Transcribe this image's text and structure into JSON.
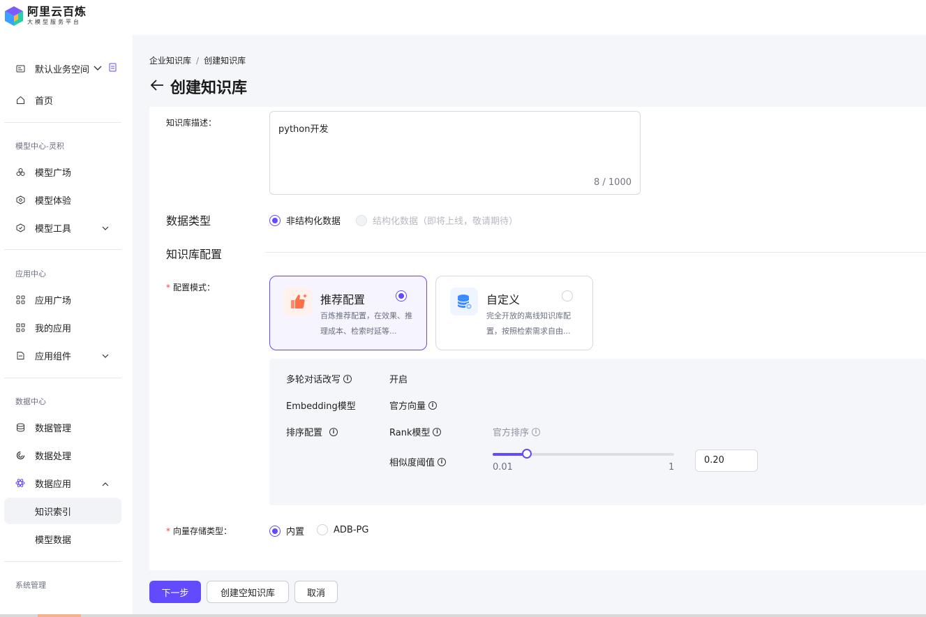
{
  "app": {
    "logo_title": "阿里云百炼",
    "logo_subtitle": "大模型服务平台"
  },
  "sidebar": {
    "workspace_label": "默认业务空间",
    "home_label": "首页",
    "groups": [
      {
        "title": "模型中心-灵积",
        "items": [
          {
            "label": "模型广场",
            "icon": "model-square-icon"
          },
          {
            "label": "模型体验",
            "icon": "model-experience-icon"
          },
          {
            "label": "模型工具",
            "icon": "model-tools-icon",
            "expandable": true
          }
        ]
      },
      {
        "title": "应用中心",
        "items": [
          {
            "label": "应用广场",
            "icon": "app-square-icon"
          },
          {
            "label": "我的应用",
            "icon": "my-apps-icon"
          },
          {
            "label": "应用组件",
            "icon": "app-components-icon",
            "expandable": true
          }
        ]
      },
      {
        "title": "数据中心",
        "items": [
          {
            "label": "数据管理",
            "icon": "database-icon"
          },
          {
            "label": "数据处理",
            "icon": "data-processing-icon"
          },
          {
            "label": "数据应用",
            "icon": "data-application-icon",
            "expandable": true,
            "expanded": true
          }
        ]
      }
    ],
    "sub_items": [
      {
        "label": "知识索引",
        "active": true
      },
      {
        "label": "模型数据",
        "active": false
      }
    ],
    "system_label": "系统管理"
  },
  "breadcrumb": {
    "parent": "企业知识库",
    "separator": "/",
    "current": "创建知识库"
  },
  "page": {
    "title": "创建知识库"
  },
  "form": {
    "description_label": "知识库描述：",
    "description_value": "python开发",
    "description_count": "8 / 1000",
    "data_type_label": "数据类型",
    "data_type_options": [
      {
        "label": "非结构化数据",
        "selected": true,
        "disabled": false
      },
      {
        "label": "结构化数据（即将上线，敬请期待）",
        "selected": false,
        "disabled": true
      }
    ],
    "kb_config_title": "知识库配置",
    "config_mode_label": "配置模式：",
    "modes": [
      {
        "title": "推荐配置",
        "desc": "百炼推荐配置，在效果、推理成本、检索时延等...",
        "selected": true,
        "icon": "thumbs-up-icon"
      },
      {
        "title": "自定义",
        "desc": "完全开放的离线知识库配置，按照检索需求自由...",
        "selected": false,
        "icon": "database-settings-icon"
      }
    ],
    "config": {
      "multi_turn_label": "多轮对话改写",
      "multi_turn_value": "开启",
      "embedding_label": "Embedding模型",
      "embedding_value": "官方向量",
      "rerank_label": "排序配置",
      "rank_model_label": "Rank模型",
      "rank_model_value": "官方排序",
      "similarity_label": "相似度阈值",
      "similarity_min": "0.01",
      "similarity_max": "1",
      "similarity_value": "0.20",
      "similarity_fraction": 0.19
    },
    "vector_store_label": "向量存储类型：",
    "vector_store_options": [
      {
        "label": "内置",
        "selected": true
      },
      {
        "label": "ADB-PG",
        "selected": false
      }
    ]
  },
  "actions": {
    "next": "下一步",
    "create_empty": "创建空知识库",
    "cancel": "取消"
  },
  "colors": {
    "primary": "#624aff",
    "required": "#e5484d"
  }
}
